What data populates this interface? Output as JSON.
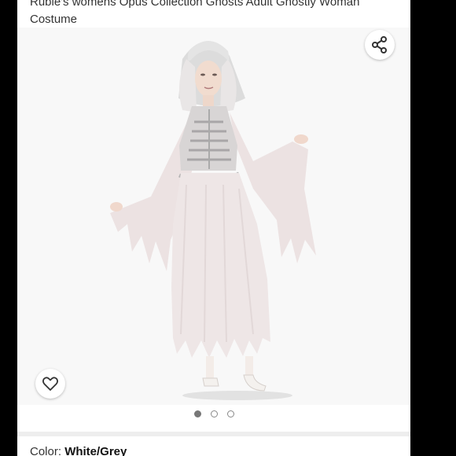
{
  "product": {
    "title": "Rubie's womens Opus Collection Ghosts Adult Ghostly Woman Costume"
  },
  "gallery": {
    "image_alt": "Ghostly Woman Costume",
    "image_count": 3,
    "active_index": 0,
    "share_icon": "share-icon",
    "favorite_icon": "heart-icon"
  },
  "variation": {
    "label": "Color: ",
    "value": "White/Grey"
  }
}
